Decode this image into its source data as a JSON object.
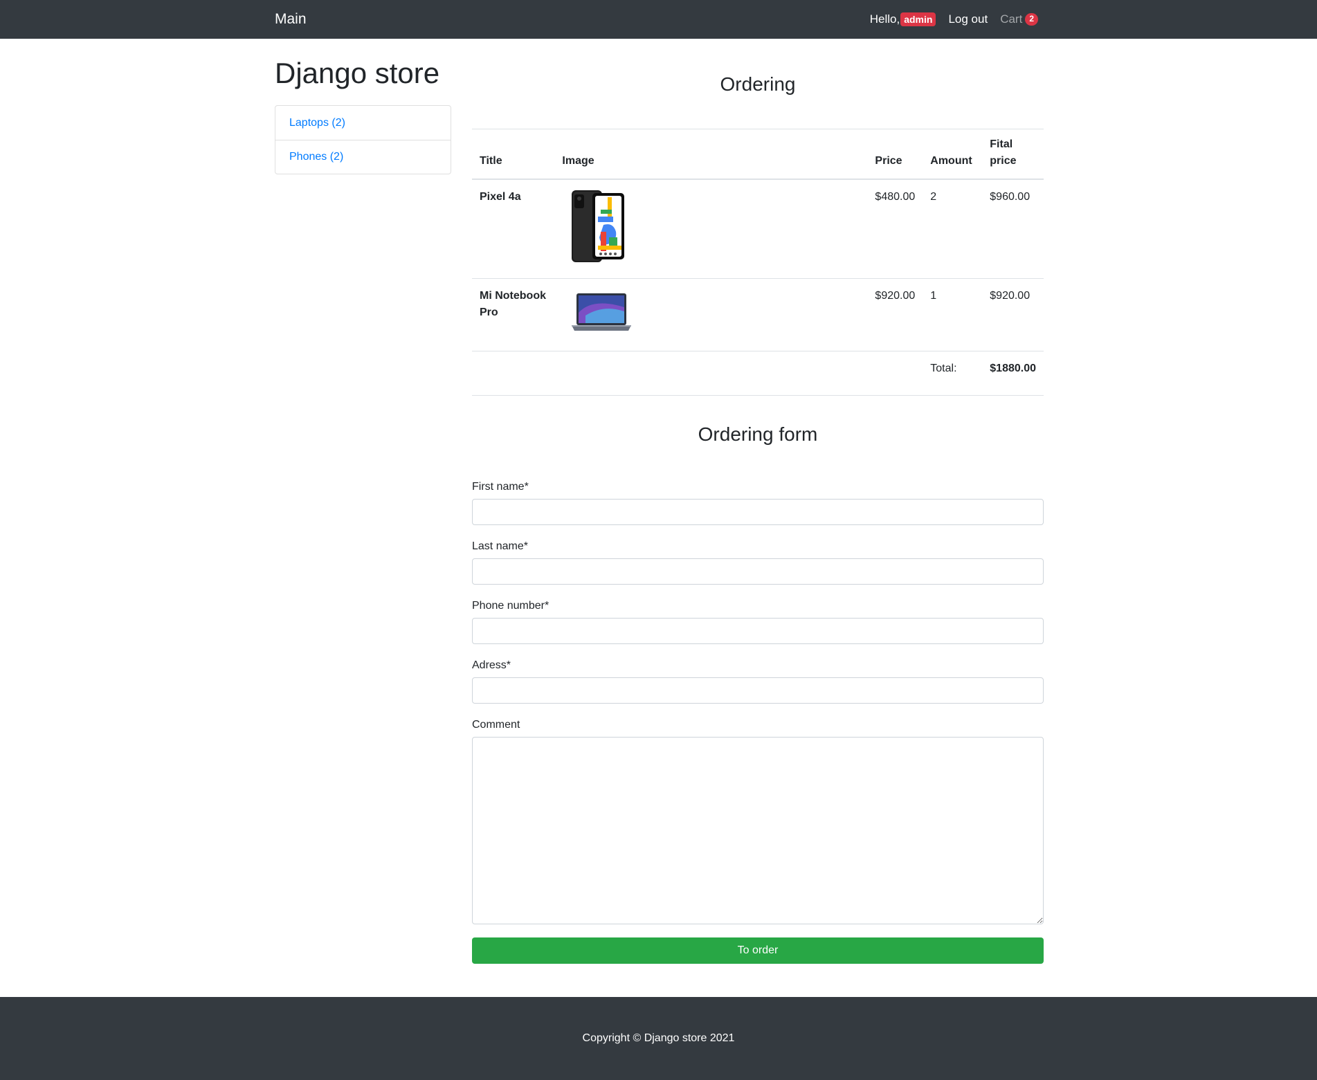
{
  "navbar": {
    "brand": "Main",
    "hello_label": "Hello,",
    "username": "admin",
    "logout_label": "Log out",
    "cart_label": "Cart",
    "cart_count": "2"
  },
  "sidebar": {
    "store_title": "Django store",
    "categories": [
      {
        "label": "Laptops (2)"
      },
      {
        "label": "Phones (2)"
      }
    ]
  },
  "cart": {
    "heading": "Ordering",
    "columns": {
      "title": "Title",
      "image": "Image",
      "price": "Price",
      "amount": "Amount",
      "final_price_line1": "Fital",
      "final_price_line2": "price"
    },
    "items": [
      {
        "title": "Pixel 4a",
        "image_icon": "phone-image",
        "price": "$480.00",
        "amount": "2",
        "final_price": "$960.00"
      },
      {
        "title": "Mi Notebook Pro",
        "image_icon": "laptop-image",
        "price": "$920.00",
        "amount": "1",
        "final_price": "$920.00"
      }
    ],
    "total_label": "Total:",
    "total_value": "$1880.00"
  },
  "form": {
    "heading": "Ordering form",
    "first_name_label": "First name*",
    "first_name_value": "",
    "last_name_label": "Last name*",
    "last_name_value": "",
    "phone_label": "Phone number*",
    "phone_value": "",
    "address_label": "Adress*",
    "address_value": "",
    "comment_label": "Comment",
    "comment_value": "",
    "submit_label": "To order"
  },
  "footer": {
    "copyright": "Copyright © Django store 2021"
  },
  "colors": {
    "navbar_bg": "#343a40",
    "link": "#007bff",
    "badge": "#dc3545",
    "submit": "#28a745"
  }
}
